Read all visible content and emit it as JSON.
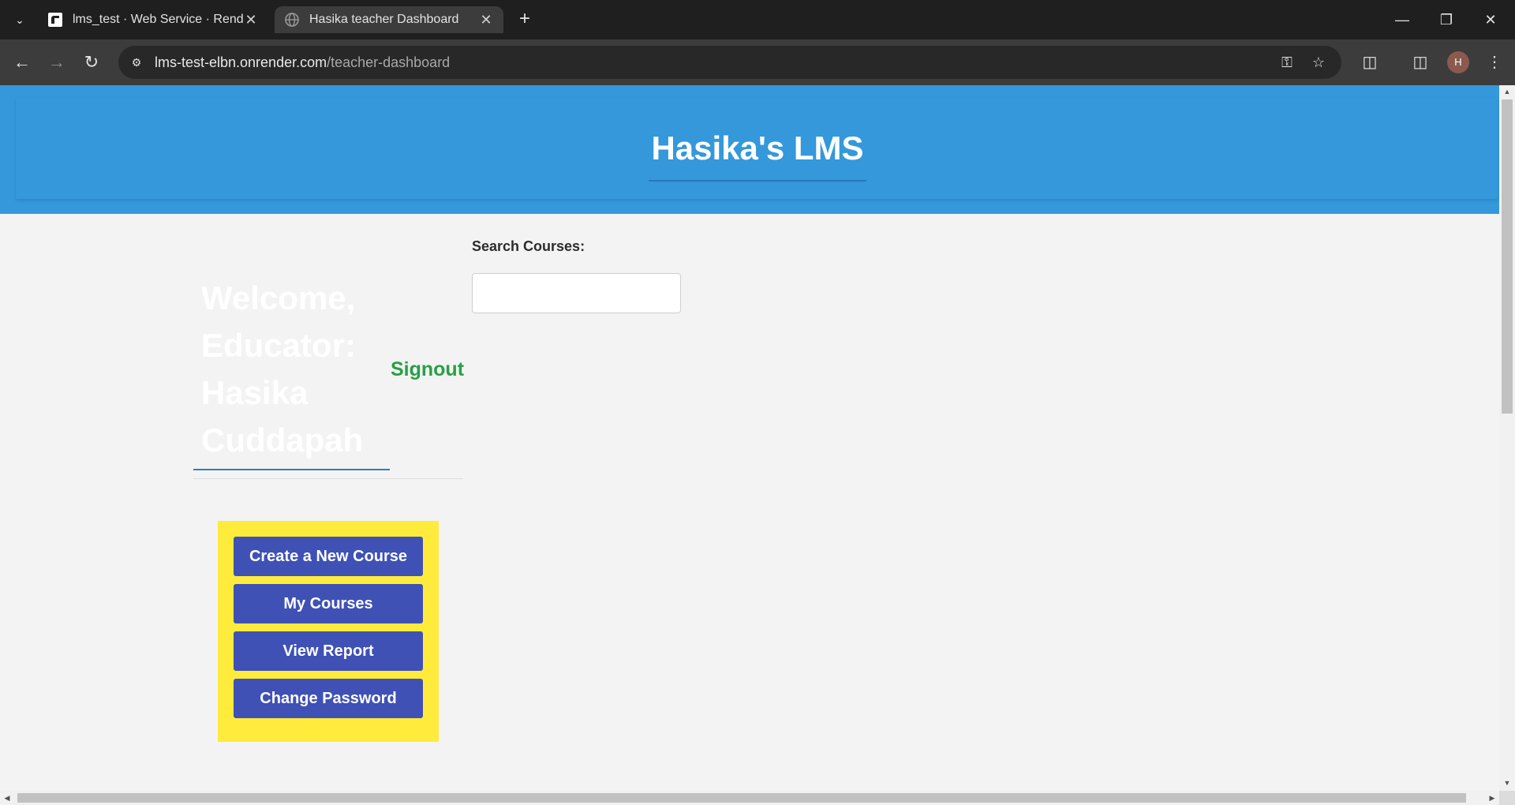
{
  "browser": {
    "tabs": [
      {
        "title": "lms_test · Web Service · Render",
        "active": false
      },
      {
        "title": "Hasika teacher Dashboard",
        "active": true
      }
    ],
    "url_host": "lms-test-elbn.onrender.com",
    "url_path": "/teacher-dashboard",
    "profile_initial": "H"
  },
  "header": {
    "title": "Hasika's LMS"
  },
  "welcome": {
    "lines": [
      "Welcome,",
      "Educator:",
      "Hasika",
      "Cuddapah"
    ]
  },
  "signout_label": "Signout",
  "search": {
    "label": "Search Courses:",
    "value": "",
    "placeholder": ""
  },
  "menu": {
    "buttons": [
      {
        "label": "Create a New Course"
      },
      {
        "label": "My Courses"
      },
      {
        "label": "View Report"
      },
      {
        "label": "Change Password"
      }
    ]
  },
  "colors": {
    "header_bg": "#3498db",
    "menu_bg": "#ffeb3b",
    "menu_button_bg": "#3f51b5",
    "signout": "#27a046"
  },
  "icons": {
    "tab_search": "chevron-down-icon",
    "back": "arrow-left-icon",
    "forward": "arrow-right-icon",
    "reload": "reload-icon",
    "site_info": "site-info-icon",
    "password": "key-icon",
    "bookmark": "star-icon",
    "extensions": "puzzle-icon",
    "side_panel": "side-panel-icon",
    "menu": "kebab-menu-icon"
  }
}
